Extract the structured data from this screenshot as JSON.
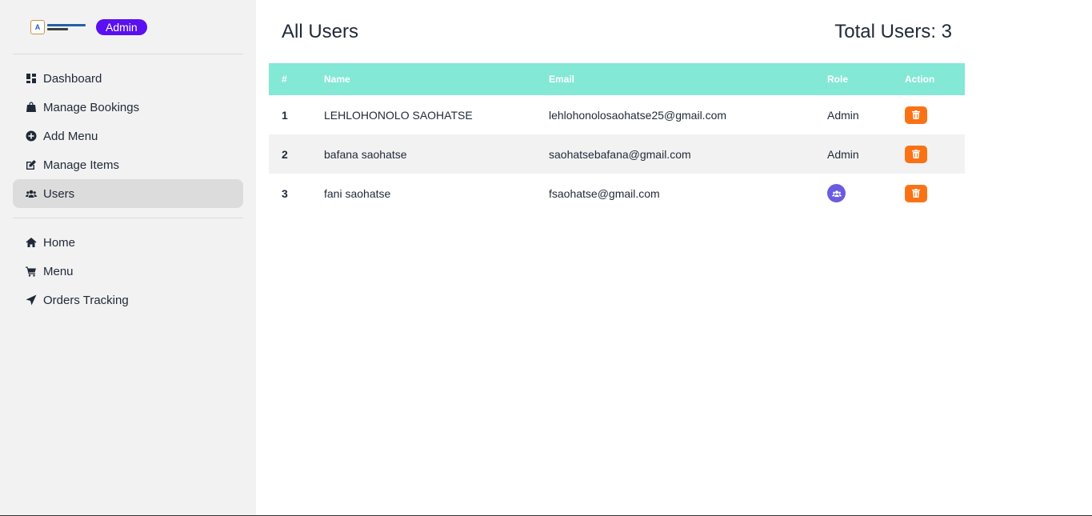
{
  "sidebar": {
    "badge": "Admin",
    "primary_nav": [
      {
        "label": "Dashboard",
        "icon": "dashboard-icon",
        "active": false
      },
      {
        "label": "Manage Bookings",
        "icon": "shopping-bag-icon",
        "active": false
      },
      {
        "label": "Add Menu",
        "icon": "plus-circle-icon",
        "active": false
      },
      {
        "label": "Manage Items",
        "icon": "edit-icon",
        "active": false
      },
      {
        "label": "Users",
        "icon": "users-icon",
        "active": true
      }
    ],
    "secondary_nav": [
      {
        "label": "Home",
        "icon": "home-icon"
      },
      {
        "label": "Menu",
        "icon": "cart-icon"
      },
      {
        "label": "Orders Tracking",
        "icon": "location-arrow-icon"
      }
    ]
  },
  "main": {
    "title": "All Users",
    "total_users": "Total Users: 3",
    "table": {
      "headers": [
        "#",
        "Name",
        "Email",
        "Role",
        "Action"
      ],
      "rows": [
        {
          "num": "1",
          "name": "LEHLOHONOLO SAOHATSE",
          "email": "lehlohonolosaohatse25@gmail.com",
          "role": "Admin"
        },
        {
          "num": "2",
          "name": "bafana saohatse",
          "email": "saohatsebafana@gmail.com",
          "role": "Admin"
        },
        {
          "num": "3",
          "name": "fani saohatse",
          "email": "fsaohatse@gmail.com",
          "role": null
        }
      ]
    }
  },
  "colors": {
    "badge": "#5a10f0",
    "table_header": "#84e8d6",
    "delete_button": "#f97316",
    "role_button": "#6a5be0",
    "sidebar_bg": "#f2f2f2"
  }
}
